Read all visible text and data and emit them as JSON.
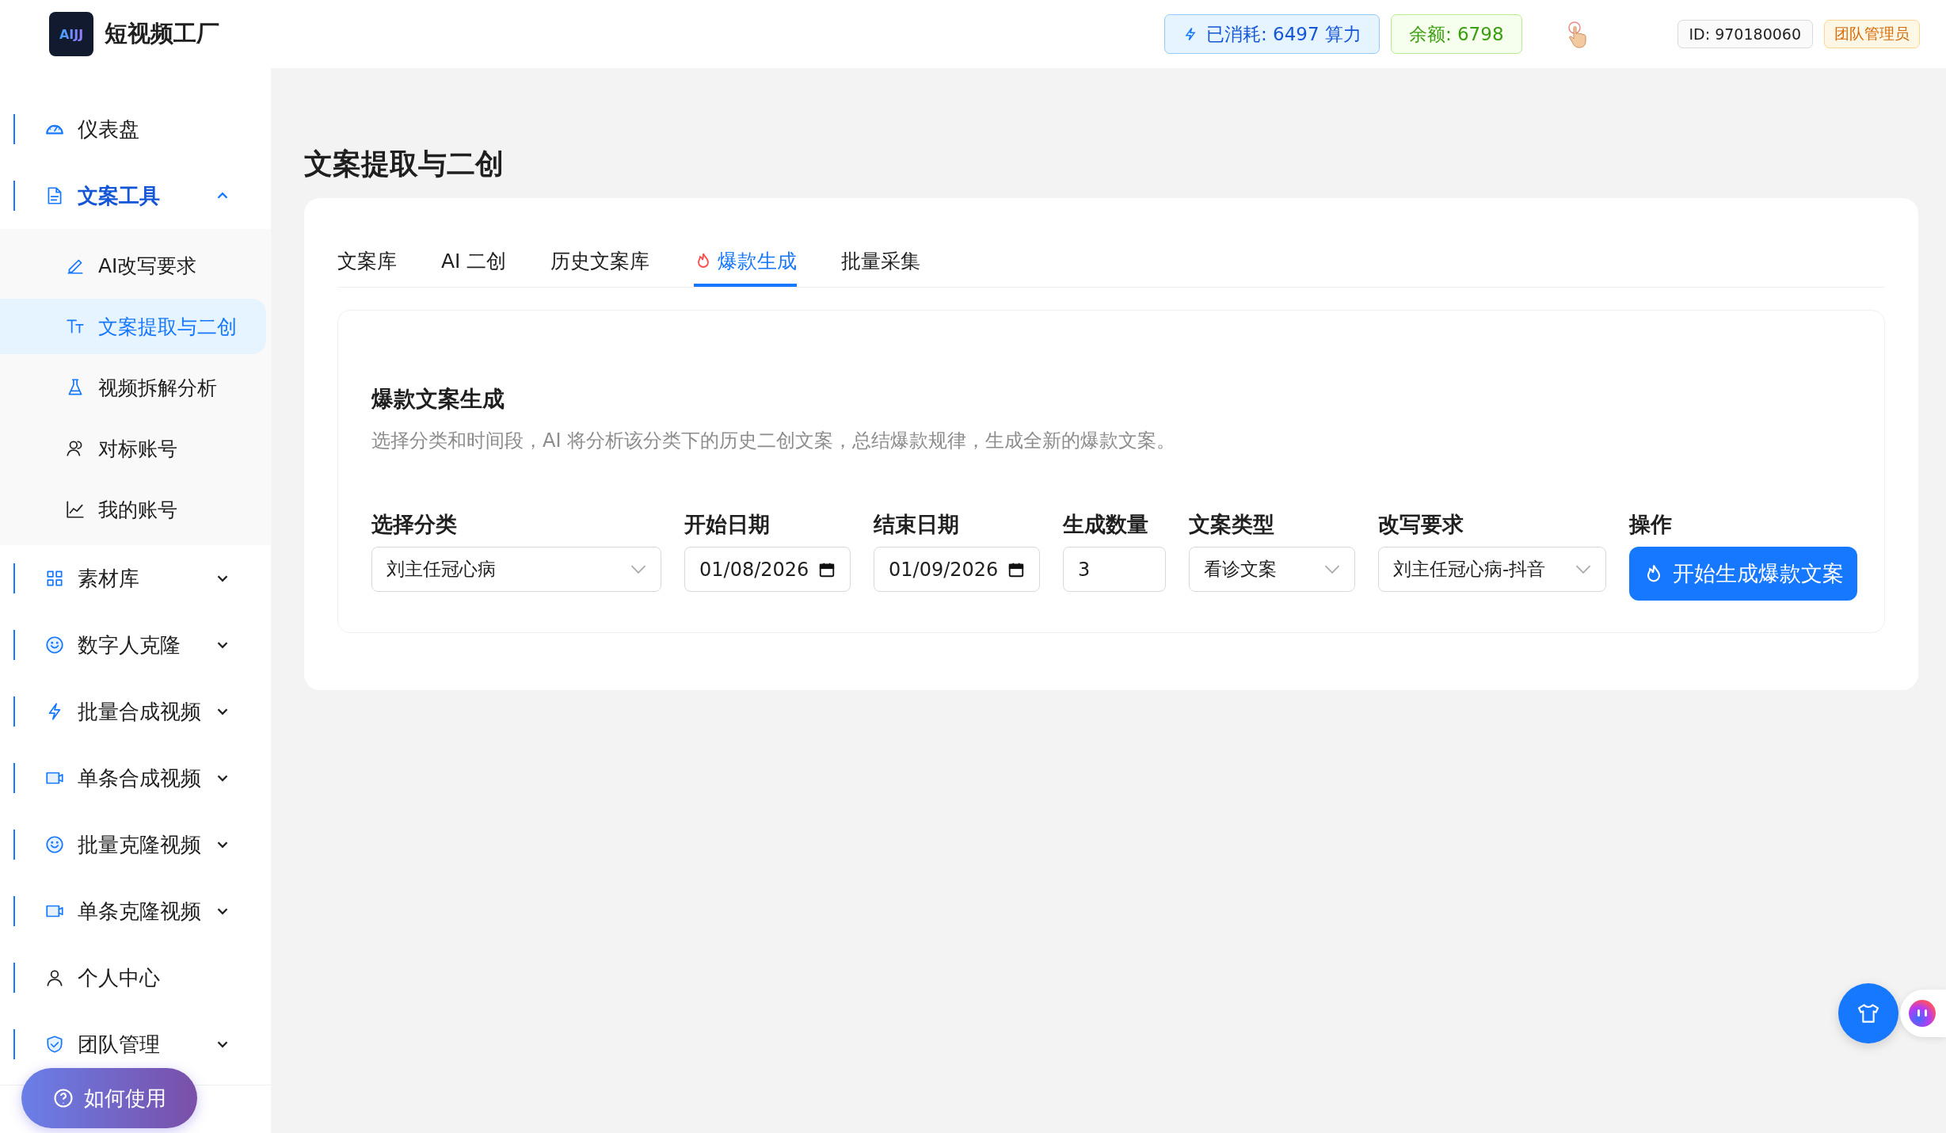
{
  "brand": {
    "logo": "AIJJ",
    "name": "短视频工厂"
  },
  "header": {
    "consumed": "已消耗: 6497 算力",
    "balance": "余额: 6798",
    "user_id": "ID: 970180060",
    "role": "团队管理员"
  },
  "sidebar": {
    "items": [
      {
        "label": "仪表盘",
        "selected": false
      },
      {
        "label": "文案工具",
        "selected": true,
        "expanded": true,
        "children": [
          {
            "label": "AI改写要求",
            "selected": false
          },
          {
            "label": "文案提取与二创",
            "selected": true
          },
          {
            "label": "视频拆解分析",
            "selected": false
          },
          {
            "label": "对标账号",
            "selected": false
          },
          {
            "label": "我的账号",
            "selected": false
          }
        ]
      },
      {
        "label": "素材库",
        "selected": false,
        "expanded": false
      },
      {
        "label": "数字人克隆",
        "selected": false,
        "expanded": false
      },
      {
        "label": "批量合成视频",
        "selected": false,
        "expanded": false
      },
      {
        "label": "单条合成视频",
        "selected": false,
        "expanded": false
      },
      {
        "label": "批量克隆视频",
        "selected": false,
        "expanded": false
      },
      {
        "label": "单条克隆视频",
        "selected": false,
        "expanded": false
      },
      {
        "label": "个人中心",
        "selected": false
      },
      {
        "label": "团队管理",
        "selected": false,
        "expanded": false
      }
    ],
    "help_button": "如何使用"
  },
  "page": {
    "title": "文案提取与二创"
  },
  "tabs": [
    {
      "label": "文案库",
      "selected": false
    },
    {
      "label": "AI 二创",
      "selected": false
    },
    {
      "label": "历史文案库",
      "selected": false
    },
    {
      "label": "爆款生成",
      "selected": true
    },
    {
      "label": "批量采集",
      "selected": false
    }
  ],
  "panel": {
    "title": "爆款文案生成",
    "description": "选择分类和时间段，AI 将分析该分类下的历史二创文案，总结爆款规律，生成全新的爆款文案。",
    "fields": [
      {
        "kind": "select",
        "label": "选择分类",
        "value": "刘主任冠心病"
      },
      {
        "kind": "date",
        "label": "开始日期",
        "value": "01/08/2026"
      },
      {
        "kind": "date",
        "label": "结束日期",
        "value": "01/09/2026"
      },
      {
        "kind": "number",
        "label": "生成数量",
        "value": "3"
      },
      {
        "kind": "select",
        "label": "文案类型",
        "value": "看诊文案"
      },
      {
        "kind": "select",
        "label": "改写要求",
        "value": "刘主任冠心病-抖音"
      },
      {
        "kind": "button",
        "label": "操作",
        "value": "开始生成爆款文案"
      }
    ]
  }
}
